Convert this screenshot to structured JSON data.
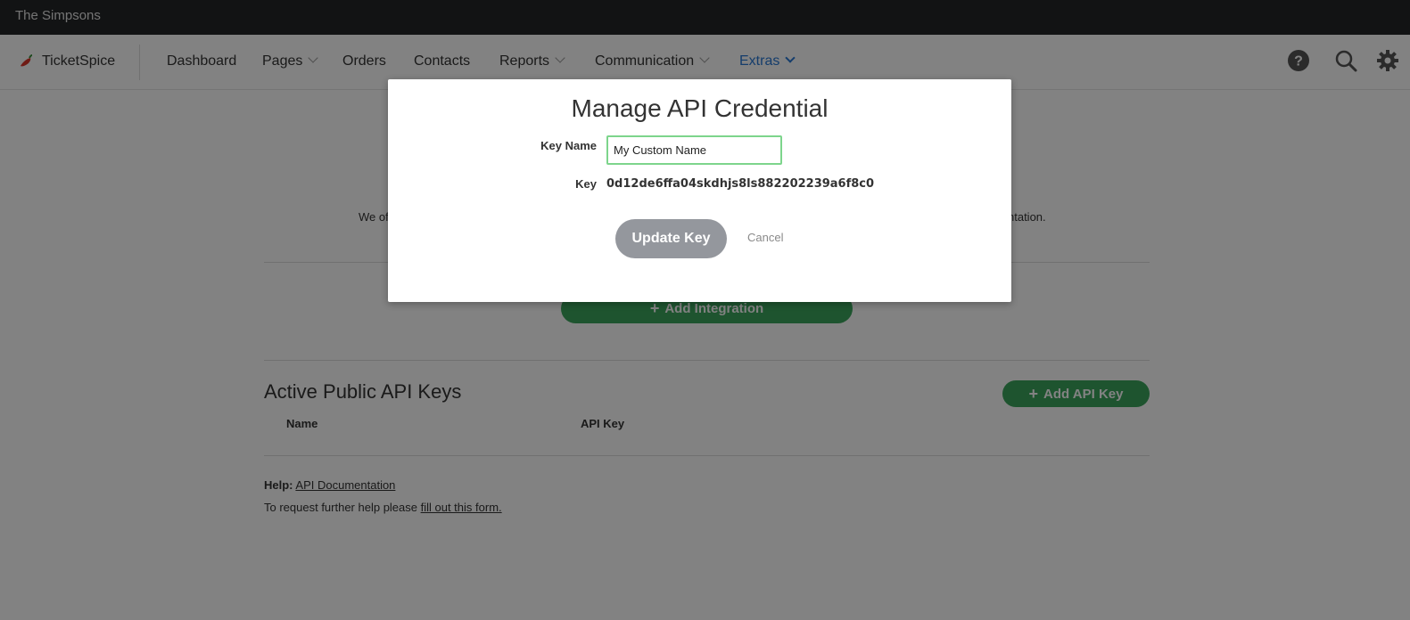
{
  "topbar": {
    "title": "The Simpsons"
  },
  "nav": {
    "brand": "TicketSpice",
    "items": [
      {
        "label": "Dashboard"
      },
      {
        "label": "Pages"
      },
      {
        "label": "Orders"
      },
      {
        "label": "Contacts"
      },
      {
        "label": "Reports"
      },
      {
        "label": "Communication"
      },
      {
        "label": "Extras"
      }
    ],
    "icons": [
      "help-icon",
      "search-icon",
      "gear-icon"
    ]
  },
  "content": {
    "intro_start": "We of",
    "intro_end": "ntation.",
    "add_integration_label": "Add Integration",
    "keys_title": "Active Public API Keys",
    "add_api_key_label": "Add API Key",
    "columns": [
      "Name",
      "API Key"
    ],
    "help_label": "Help:",
    "help_link": "API Documentation",
    "request_text": "To request further help please ",
    "request_link": "fill out this form."
  },
  "modal": {
    "title": "Manage API Credential",
    "key_name_label": "Key Name",
    "key_name_value": "My Custom Name",
    "key_label": "Key",
    "key_value": "0d12de6ffa04skdhjs8ls882202239a6f8c0",
    "update_label": "Update Key",
    "cancel_label": "Cancel"
  },
  "colors": {
    "accent": "#2a78d4",
    "green": "#3ba55c",
    "topbar": "#252629"
  }
}
